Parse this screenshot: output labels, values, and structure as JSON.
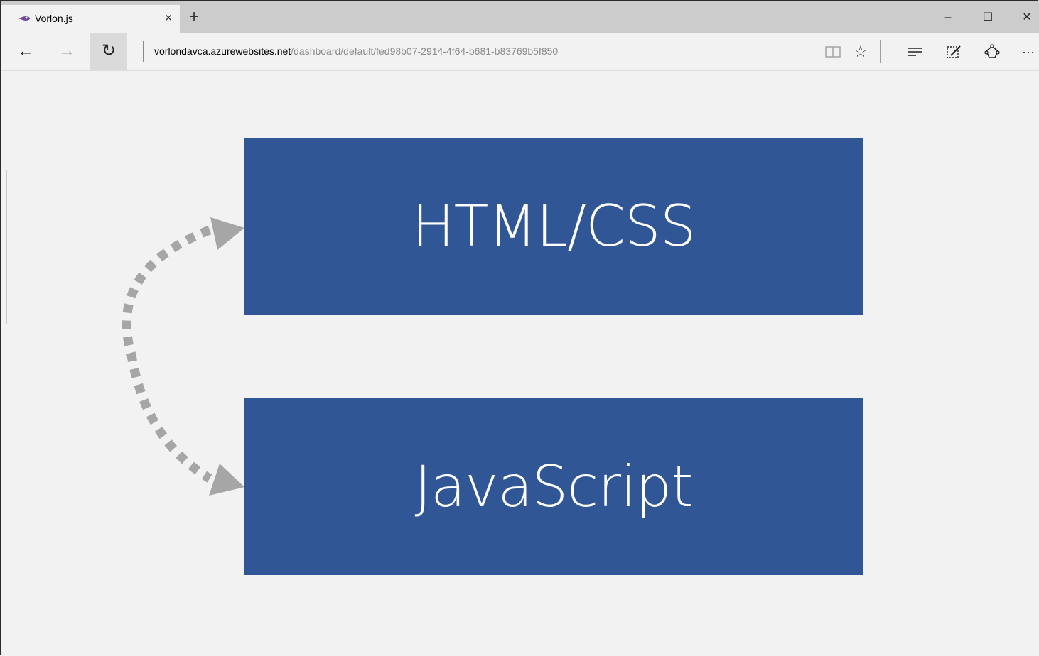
{
  "browser": {
    "tab": {
      "title": "Vorlon.js",
      "close_glyph": "×"
    },
    "new_tab_glyph": "+",
    "window_controls": {
      "minimize": "–",
      "maximize": "☐",
      "close": "✕"
    },
    "nav": {
      "back": "←",
      "forward": "→",
      "refresh": "↻"
    },
    "address": {
      "host": "vorlondavca.azurewebsites.net",
      "path": "/dashboard/default/fed98b07-2914-4f64-b681-b83769b5f850"
    },
    "toolbar": {
      "reading_view": "📖",
      "favorite": "☆",
      "hub": "≡",
      "web_note": "✎",
      "share": "⟁",
      "more": "···"
    }
  },
  "slide": {
    "box_top_label": "HTML/CSS",
    "box_bottom_label": "JavaScript",
    "arrow_color": "#a6a6a6",
    "box_color": "#315696"
  }
}
